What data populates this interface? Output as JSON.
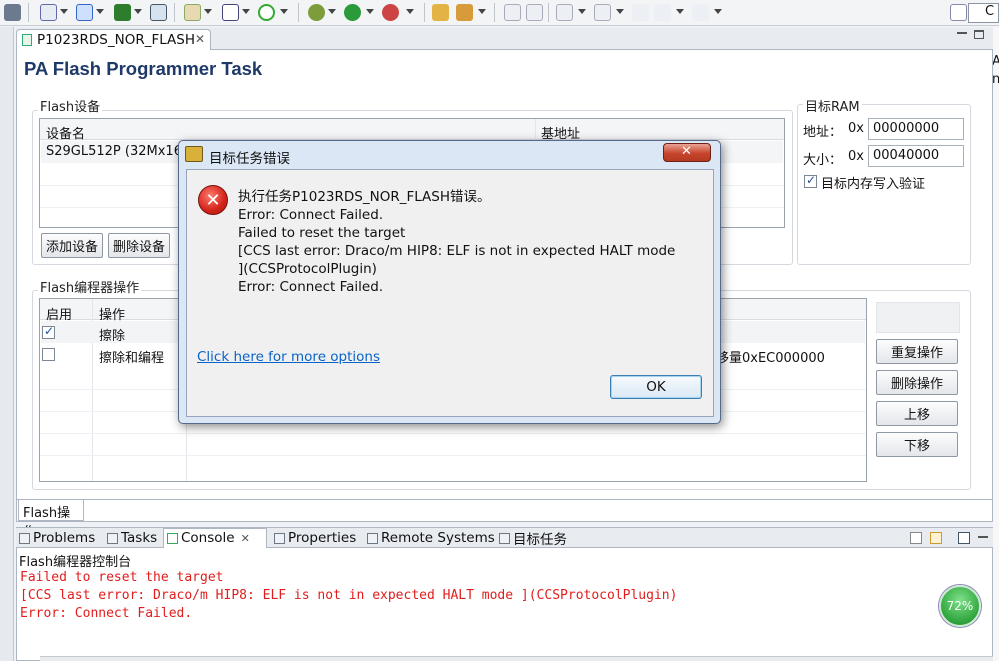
{
  "editor": {
    "tab_label": "P1023RDS_NOR_FLASH",
    "title": "PA Flash Programmer Task"
  },
  "flash_devices": {
    "group_title": "Flash设备",
    "columns": [
      "设备名",
      "基地址"
    ],
    "row_device": "S29GL512P (32Mx16",
    "add_button": "添加设备",
    "remove_button": "删除设备"
  },
  "target_ram": {
    "group_title": "目标RAM",
    "address_label": "地址：",
    "size_label": "大小：",
    "prefix": "0x",
    "address_value": "00000000",
    "size_value": "00040000",
    "verify_label": "目标内存写入验证",
    "verify_checked": true
  },
  "flash_ops": {
    "group_title": "Flash编程器操作",
    "columns": [
      "启用",
      "操作"
    ],
    "rows": [
      {
        "enabled": true,
        "name": "擦除"
      },
      {
        "enabled": false,
        "name": "擦除和编程"
      }
    ],
    "row2_extra": "移量0xEC000000",
    "buttons": [
      "重复操作",
      "删除操作",
      "上移",
      "下移"
    ],
    "bottom_tab": "Flash操作"
  },
  "views": {
    "tabs": [
      "Problems",
      "Tasks",
      "Console",
      "Properties",
      "Remote Systems",
      "目标任务"
    ],
    "console_title": "Flash编程器控制台",
    "console_lines": [
      "Failed to reset the target",
      "[CCS last error: Draco/m HIP8: ELF is not in expected HALT mode ](CCSProtocolPlugin)",
      "Error: Connect Failed."
    ]
  },
  "dialog": {
    "title": "目标任务错误",
    "icon": "error-icon",
    "lines": [
      "执行任务P1023RDS_NOR_FLASH错误。",
      "Error:  Connect Failed.",
      "Failed to reset the target",
      "[CCS last error: Draco/m HIP8: ELF is not in expected HALT mode",
      "](CCSProtocolPlugin)",
      "Error: Connect Failed."
    ],
    "link": "Click here for more options",
    "ok_label": "OK"
  },
  "gauge": {
    "label": "72%",
    "value": 0.72
  },
  "right_edge": {
    "char1": "A",
    "char2": "n",
    "tab_fragment": "C"
  }
}
